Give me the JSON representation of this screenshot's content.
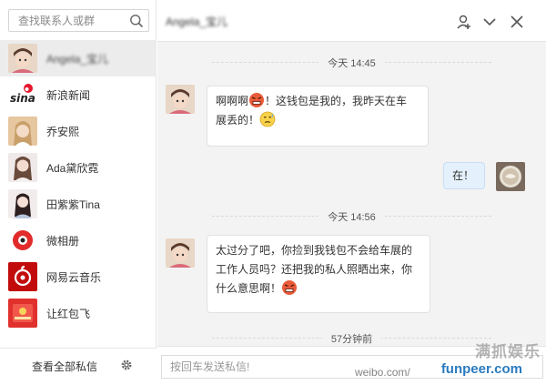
{
  "search": {
    "placeholder": "查找联系人或群"
  },
  "contacts": [
    {
      "name": "Angela_宝儿",
      "avatar": "girl-avatar",
      "active": true,
      "blurred": true
    },
    {
      "name": "新浪新闻",
      "avatar": "sina-logo"
    },
    {
      "name": "乔安熙",
      "avatar": "girl-avatar"
    },
    {
      "name": "Ada黛欣霓",
      "avatar": "girl-avatar"
    },
    {
      "name": "田紫紫Tina",
      "avatar": "girl-avatar"
    },
    {
      "name": "微相册",
      "avatar": "album-icon"
    },
    {
      "name": "网易云音乐",
      "avatar": "netease-music-logo"
    },
    {
      "name": "让红包飞",
      "avatar": "red-packet-icon"
    }
  ],
  "sidebar_footer": {
    "view_all": "查看全部私信",
    "settings_icon": "gear-icon"
  },
  "chat": {
    "title": "Angela_宝儿",
    "header_icons": [
      "add-user-icon",
      "chevron-down-icon",
      "close-icon"
    ],
    "messages": [
      {
        "type": "time",
        "text": "今天 14:45"
      },
      {
        "type": "in",
        "line1": "啊啊啊",
        "line1b": "！这钱包是我的，我昨天在车",
        "line2": "展丢的！",
        "emojis": [
          "angry-emoji",
          "sweat-emoji"
        ]
      },
      {
        "type": "out",
        "text": "在！"
      },
      {
        "type": "time",
        "text": "今天 14:56"
      },
      {
        "type": "in",
        "line1": "太过分了吧，你捡到我钱包不会给车展的",
        "line2": "工作人员吗？还把我的私人照晒出来，你",
        "line3": "什么意思啊！",
        "emojis": [
          "angry-emoji"
        ]
      },
      {
        "type": "time",
        "text": "57分钟前"
      }
    ],
    "compose_placeholder": "按回车发送私信!"
  },
  "watermark": {
    "top": "满抓娱乐",
    "weibo": "weibo.com/",
    "site": "funpeer.com"
  },
  "colors": {
    "accent": "#e4f1fd",
    "background": "#f3f3f3",
    "brand": "#2a7bbf"
  }
}
